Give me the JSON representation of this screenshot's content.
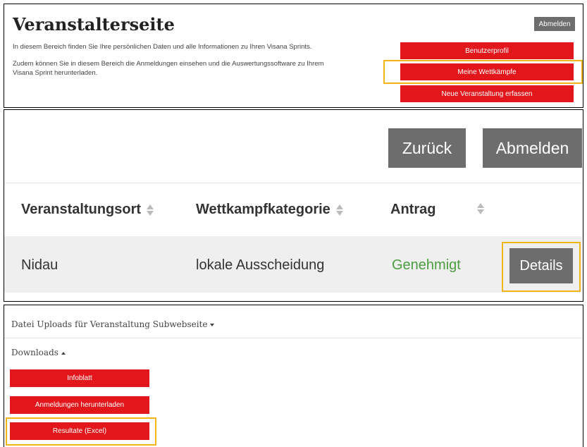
{
  "panel1": {
    "title": "Veranstalterseite",
    "intro": "In diesem Bereich finden Sie Ihre persönlichen Daten und alle Informationen zu Ihren Visana Sprints.",
    "info_line1": "Zudem können Sie in diesem Bereich die Anmeldungen einsehen und die Auswertungssoftware zu Ihrem",
    "info_line2": "Visana Sprint herunterladen.",
    "logout_label": "Abmelden",
    "menu": {
      "profile": "Benutzerprofil",
      "competitions": "Meine Wettkämpfe",
      "new_event": "Neue Veranstaltung erfassen"
    }
  },
  "panel2": {
    "back_label": "Zurück",
    "logout_label": "Abmelden",
    "table": {
      "headers": [
        "Veranstaltungsort",
        "Wettkampfkategorie",
        "Antrag"
      ],
      "rows": [
        {
          "location": "Nidau",
          "category": "lokale Ausscheidung",
          "status": "Genehmigt",
          "action": "Details"
        }
      ]
    }
  },
  "panel3": {
    "uploads_label": "Datei Uploads für Veranstaltung Subwebseite",
    "downloads_label": "Downloads",
    "buttons": {
      "infoblatt": "Infoblatt",
      "registrations": "Anmeldungen herunterladen",
      "results": "Resultate (Excel)"
    }
  },
  "colors": {
    "brand_red": "#e3161b",
    "button_gray": "#6d6d6d",
    "highlight": "#f3b513",
    "status_green": "#4a9e3f"
  }
}
